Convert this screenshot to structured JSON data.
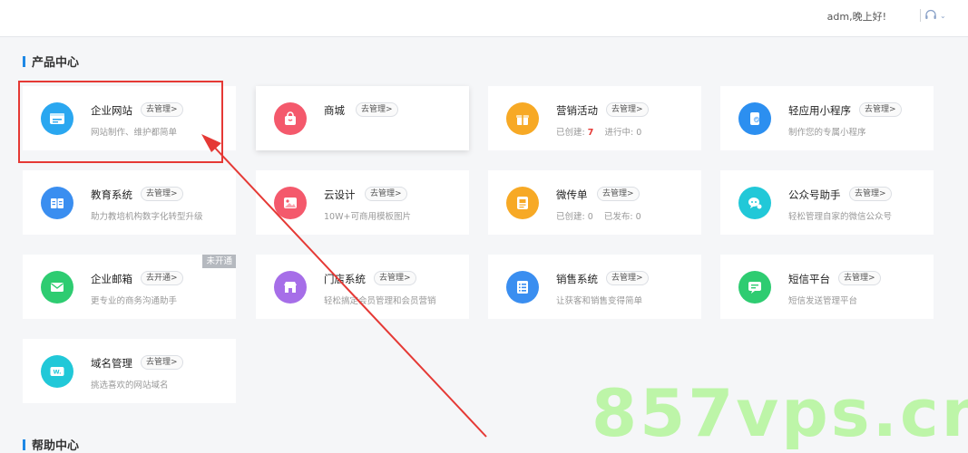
{
  "header": {
    "greeting": "adm,晚上好!",
    "service_icon": "headset-icon",
    "dropdown_icon": "chevron-down-icon"
  },
  "sections": {
    "products_title": "产品中心",
    "help_title": "帮助中心"
  },
  "cards": [
    {
      "id": "website",
      "name": "企业网站",
      "action": "去管理>",
      "desc": "网站制作、维护都简单",
      "icon": "website-icon",
      "color": "#2aa7f0"
    },
    {
      "id": "mall",
      "name": "商城",
      "action": "去管理>",
      "desc": "",
      "icon": "shopping-bag-icon",
      "color": "#f4596c"
    },
    {
      "id": "marketing",
      "name": "营销活动",
      "action": "去管理>",
      "desc_label_1": "已创建:",
      "desc_value_1": "7",
      "desc_label_2": "进行中:",
      "desc_value_2": "0",
      "icon": "gift-icon",
      "color": "#f7a925"
    },
    {
      "id": "miniapp",
      "name": "轻应用小程序",
      "action": "去管理>",
      "desc": "制作您的专属小程序",
      "icon": "miniapp-icon",
      "color": "#2c8ff0"
    },
    {
      "id": "education",
      "name": "教育系统",
      "action": "去管理>",
      "desc": "助力教培机构数字化转型升级",
      "icon": "book-icon",
      "color": "#3a8ef0"
    },
    {
      "id": "clouddesign",
      "name": "云设计",
      "action": "去管理>",
      "desc": "10W+可商用模板图片",
      "icon": "image-icon",
      "color": "#f4596c"
    },
    {
      "id": "flyer",
      "name": "微传单",
      "action": "去管理>",
      "desc_label_1": "已创建:",
      "desc_value_1": "0",
      "desc_label_2": "已发布:",
      "desc_value_2": "0",
      "icon": "flyer-icon",
      "color": "#f7a925"
    },
    {
      "id": "official",
      "name": "公众号助手",
      "action": "去管理>",
      "desc": "轻松管理自家的微信公众号",
      "icon": "wechat-icon",
      "color": "#21c8d8"
    },
    {
      "id": "email",
      "name": "企业邮箱",
      "action": "去开通>",
      "desc": "更专业的商务沟通助手",
      "icon": "mail-icon",
      "color": "#2ecc71",
      "badge": "未开通"
    },
    {
      "id": "store",
      "name": "门店系统",
      "action": "去管理>",
      "desc": "轻松搞定会员管理和会员营销",
      "icon": "store-icon",
      "color": "#a66ee8"
    },
    {
      "id": "sales",
      "name": "销售系统",
      "action": "去管理>",
      "desc": "让获客和销售变得简单",
      "icon": "list-icon",
      "color": "#3a8ef0"
    },
    {
      "id": "sms",
      "name": "短信平台",
      "action": "去管理>",
      "desc": "短信发送管理平台",
      "icon": "message-icon",
      "color": "#2ecc71"
    },
    {
      "id": "domain",
      "name": "域名管理",
      "action": "去管理>",
      "desc": "挑选喜欢的网站域名",
      "icon": "domain-icon",
      "color": "#21c8d8",
      "icon_text": "W."
    }
  ],
  "watermark": "857vps.cn"
}
